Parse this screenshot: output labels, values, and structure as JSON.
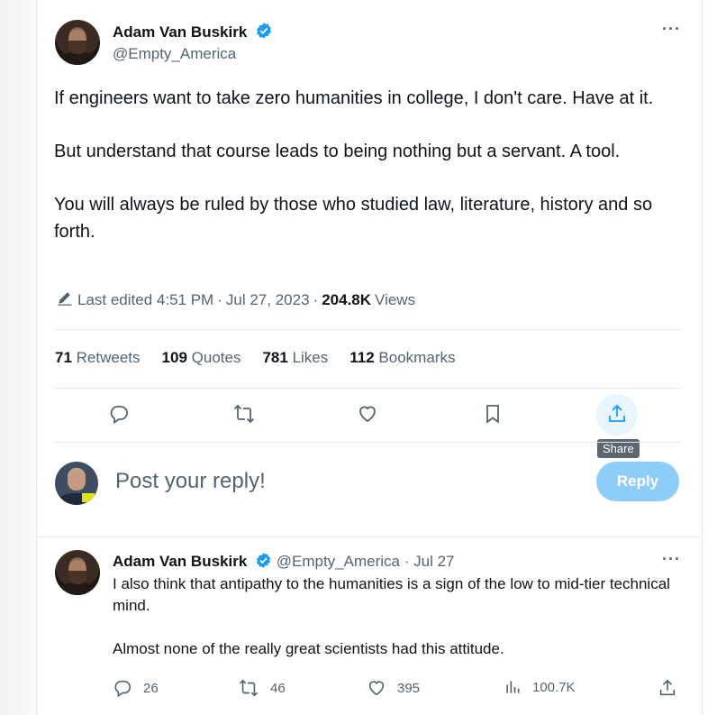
{
  "main_tweet": {
    "author_name": "Adam Van Buskirk",
    "author_handle": "@Empty_America",
    "paragraphs": [
      "If engineers want to take zero humanities in college, I don't care.  Have at it.",
      "But understand that course leads to being nothing but a servant.  A tool.",
      "You will always be ruled by those who studied law, literature, history and so forth."
    ],
    "edited_label": "Last edited 4:51 PM",
    "date": "Jul 27, 2023",
    "views_count": "204.8K",
    "views_label": "Views",
    "stats": {
      "retweets_count": "71",
      "retweets_label": "Retweets",
      "quotes_count": "109",
      "quotes_label": "Quotes",
      "likes_count": "781",
      "likes_label": "Likes",
      "bookmarks_count": "112",
      "bookmarks_label": "Bookmarks"
    },
    "share_tooltip": "Share"
  },
  "reply_composer": {
    "placeholder": "Post your reply!",
    "button_label": "Reply"
  },
  "reply_tweet": {
    "author_name": "Adam Van Buskirk",
    "author_handle": "@Empty_America",
    "separator": "·",
    "date": "Jul 27",
    "paragraphs": [
      "I also think that antipathy to the humanities is a sign of the low to mid-tier technical mind.",
      "Almost none of the really great scientists had this attitude."
    ],
    "replies": "26",
    "retweets": "46",
    "likes": "395",
    "views": "100.7K"
  },
  "colors": {
    "accent": "#1d9bf0",
    "text": "#0f1419",
    "muted": "#536471",
    "reply_button": "#8ecdf8"
  },
  "icons": [
    "verified-badge-icon",
    "more-icon",
    "edit-icon",
    "reply-icon",
    "retweet-icon",
    "like-icon",
    "bookmark-icon",
    "share-icon",
    "views-icon"
  ]
}
